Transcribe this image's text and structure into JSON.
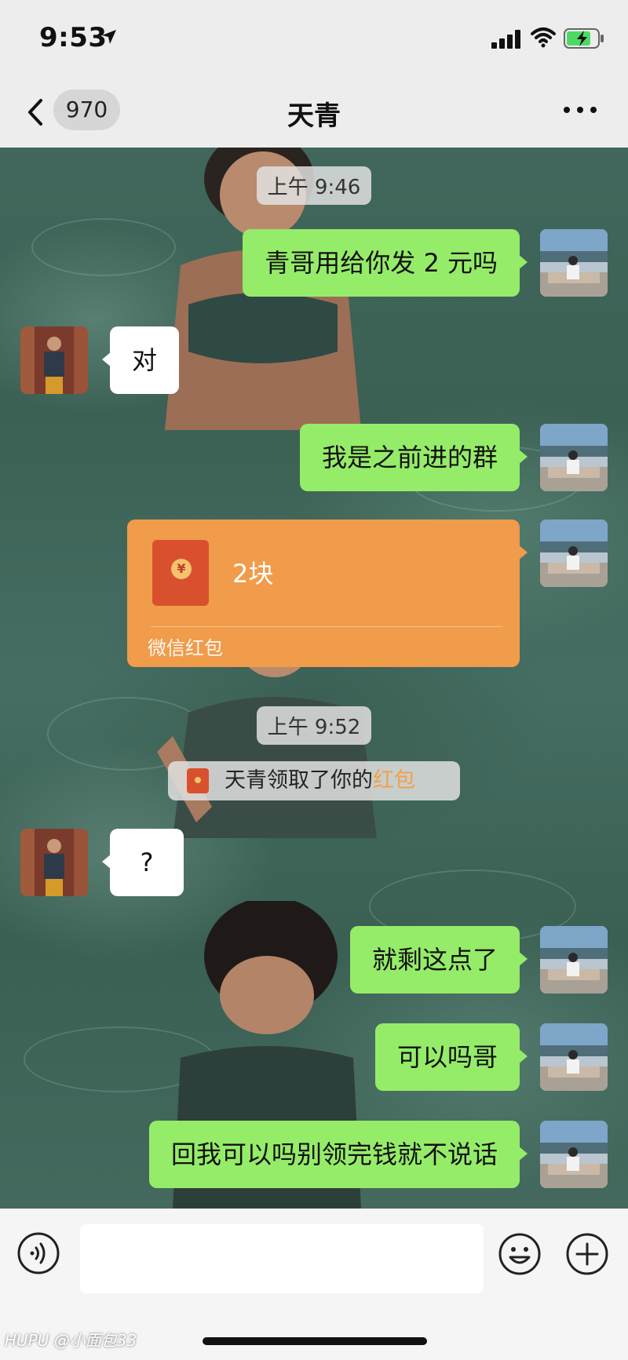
{
  "status_bar": {
    "time": "9:53",
    "icons": [
      "location-arrow-icon",
      "signal-icon",
      "wifi-icon",
      "battery-charging-icon"
    ]
  },
  "nav": {
    "back_count": "970",
    "title": "天青",
    "more_icon": "more-dots-icon"
  },
  "chat": {
    "messages": [
      {
        "type": "timestamp",
        "text": "上午 9:46"
      },
      {
        "type": "text",
        "sender": "me",
        "text": "青哥用给你发 2 元吗"
      },
      {
        "type": "text",
        "sender": "them",
        "text": "对"
      },
      {
        "type": "text",
        "sender": "me",
        "text": "我是之前进的群"
      },
      {
        "type": "red_packet",
        "sender": "me",
        "amount_text": "2块",
        "source": "微信红包"
      },
      {
        "type": "timestamp",
        "text": "上午 9:52"
      },
      {
        "type": "system",
        "prefix": "天青领取了你的",
        "highlight": "红包"
      },
      {
        "type": "text",
        "sender": "them",
        "text": "?"
      },
      {
        "type": "text",
        "sender": "me",
        "text": "就剩这点了"
      },
      {
        "type": "text",
        "sender": "me",
        "text": "可以吗哥"
      },
      {
        "type": "text",
        "sender": "me",
        "text": "回我可以吗别领完钱就不说话"
      }
    ]
  },
  "input_bar": {
    "value": "",
    "icons": [
      "voice-icon",
      "emoji-icon",
      "plus-icon"
    ]
  },
  "watermark": "HUPU @小面包33",
  "colors": {
    "my_bubble": "#95ec69",
    "their_bubble": "#ffffff",
    "red_packet": "#f09c4a",
    "background": "#ededed"
  }
}
